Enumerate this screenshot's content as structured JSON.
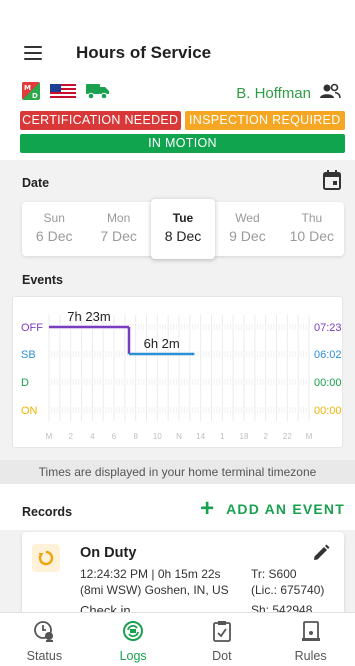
{
  "header": {
    "title": "Hours of Service",
    "driver_name": "B. Hoffman"
  },
  "badges": {
    "certification": "CERTIFICATION NEEDED",
    "inspection": "INSPECTION REQUIRED",
    "motion": "IN MOTION"
  },
  "date_section": {
    "label": "Date",
    "days": [
      {
        "dow": "Sun",
        "dm": "6 Dec"
      },
      {
        "dow": "Mon",
        "dm": "7 Dec"
      },
      {
        "dow": "Tue",
        "dm": "8 Dec"
      },
      {
        "dow": "Wed",
        "dm": "9 Dec"
      },
      {
        "dow": "Thu",
        "dm": "10 Dec"
      }
    ],
    "selected": "Tue"
  },
  "events_section": {
    "label": "Events"
  },
  "chart_data": {
    "type": "line",
    "rows": [
      "OFF",
      "SB",
      "D",
      "ON"
    ],
    "row_colors": [
      "#7a3dbf",
      "#2d8fd6",
      "#1aa14f",
      "#f0b400"
    ],
    "totals": [
      "07:23",
      "06:02",
      "00:00",
      "00:00"
    ],
    "x_ticks": [
      "M",
      "2",
      "4",
      "6",
      "8",
      "10",
      "N",
      "14",
      "1",
      "18",
      "2",
      "22",
      "M"
    ],
    "segments": [
      {
        "status": "OFF",
        "start_hour": 0,
        "end_hour": 7.383,
        "label": "7h 23m"
      },
      {
        "status": "SB",
        "start_hour": 7.383,
        "end_hour": 13.417,
        "label": "6h 2m"
      }
    ],
    "x_range": [
      0,
      24
    ]
  },
  "timezone_note": "Times are displayed in your home terminal timezone",
  "records": {
    "label": "Records",
    "add_label": "ADD AN EVENT",
    "items": [
      {
        "title": "On Duty",
        "time": "12:24:32 PM | 0h 15m 22s",
        "location": "(8mi WSW) Goshen, IN, US",
        "note": "Check in",
        "trailer": "Tr: S600",
        "license": "(Lic.: 675740)",
        "shipping": "Sh: 542948"
      }
    ]
  },
  "nav": {
    "items": [
      {
        "label": "Status",
        "icon": "status-icon"
      },
      {
        "label": "Logs",
        "icon": "logs-icon"
      },
      {
        "label": "Dot",
        "icon": "dot-icon"
      },
      {
        "label": "Rules",
        "icon": "rules-icon"
      }
    ],
    "active": "Logs"
  },
  "colors": {
    "accent_green": "#1aa14f",
    "badge_red": "#d93838",
    "badge_orange": "#f5a623",
    "badge_green": "#11a44f"
  }
}
